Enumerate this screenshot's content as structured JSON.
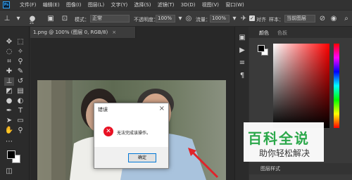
{
  "app": {
    "logo": "Ps"
  },
  "menu": [
    "文件(F)",
    "编辑(E)",
    "图像(I)",
    "图层(L)",
    "文字(Y)",
    "选择(S)",
    "滤镜(T)",
    "3D(D)",
    "视图(V)",
    "窗口(W)"
  ],
  "options": {
    "brush_size": "21",
    "mode_label": "模式：",
    "mode_value": "正常",
    "opacity_label": "不透明度：",
    "opacity_value": "100%",
    "flow_label": "流量：",
    "flow_value": "100%",
    "align_label": "对齐",
    "sample_label": "样本：",
    "sample_value": "当前图层"
  },
  "document": {
    "tab_title": "1.png @ 100% (图层 0, RGB/8)",
    "close": "×"
  },
  "panel": {
    "tab_color": "颜色",
    "tab_swatches": "色板",
    "layer_style_label": "图层样式"
  },
  "dialog": {
    "title": "错误",
    "message": "无法完成该操作。",
    "ok_label": "确定",
    "close": "×"
  },
  "watermark": {
    "line1": "百科全说",
    "line2": "助你轻松解决"
  },
  "colors": {
    "error_red": "#e81123",
    "watermark_green": "#2ba84a",
    "arrow_red": "#e0242b"
  }
}
